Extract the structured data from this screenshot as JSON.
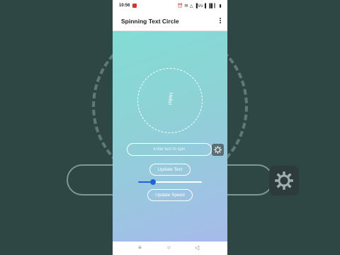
{
  "status_bar": {
    "time": "10:56",
    "icons": "⏰ ✉ △ ▐Vo▐ ▐▌▎ ▮"
  },
  "app": {
    "title": "Spinning Text Circle"
  },
  "spinner": {
    "text": "Hello!"
  },
  "input": {
    "placeholder": "Enter text to spin",
    "value": ""
  },
  "buttons": {
    "update_text": "Update Text",
    "update_speed": "Update Speed"
  },
  "speed_slider": {
    "fraction": 0.23
  },
  "nav": {
    "recents": "≡",
    "home": "○",
    "back": "◁"
  },
  "colors": {
    "accent": "#1e64d6",
    "gradient_start": "#7fe0d4",
    "gradient_end": "#a9b8ec"
  }
}
